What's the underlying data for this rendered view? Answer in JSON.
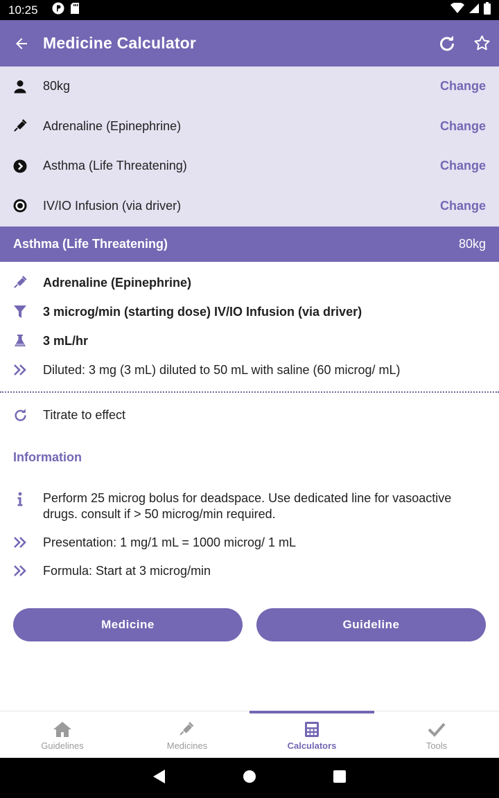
{
  "status_bar": {
    "time": "10:25"
  },
  "app_bar": {
    "title": "Medicine Calculator"
  },
  "selectors": [
    {
      "icon": "person-icon",
      "text": "80kg",
      "action": "Change"
    },
    {
      "icon": "syringe-icon",
      "text": "Adrenaline (Epinephrine)",
      "action": "Change"
    },
    {
      "icon": "chevron-circle-icon",
      "text": "Asthma (Life Threatening)",
      "action": "Change"
    },
    {
      "icon": "radio-dot-icon",
      "text": "IV/IO Infusion (via driver)",
      "action": "Change"
    }
  ],
  "band": {
    "condition": "Asthma (Life Threatening)",
    "weight": "80kg"
  },
  "dose": {
    "medicine": "Adrenaline (Epinephrine)",
    "dose_route": "3 microg/min (starting dose) IV/IO Infusion (via driver)",
    "rate": "3 mL/hr",
    "dilution": "Diluted: 3 mg (3 mL) diluted to 50 mL with saline (60 microg/ mL)"
  },
  "titrate": "Titrate to effect",
  "information": {
    "heading": "Information",
    "items": [
      "Perform 25 microg bolus for deadspace. Use dedicated line for vasoactive drugs. consult if > 50 microg/min required.",
      "Presentation: 1 mg/1 mL = 1000 microg/ 1 mL",
      "Formula: Start at 3 microg/min"
    ]
  },
  "buttons": {
    "medicine": "Medicine",
    "guideline": "Guideline"
  },
  "bottom_nav": [
    {
      "label": "Guidelines",
      "icon": "home-icon"
    },
    {
      "label": "Medicines",
      "icon": "syringe-icon"
    },
    {
      "label": "Calculators",
      "icon": "calculator-icon"
    },
    {
      "label": "Tools",
      "icon": "check-icon"
    }
  ],
  "bottom_nav_active": "Calculators",
  "colors": {
    "accent": "#7467b3",
    "selector_bg": "#e4e1f1"
  }
}
